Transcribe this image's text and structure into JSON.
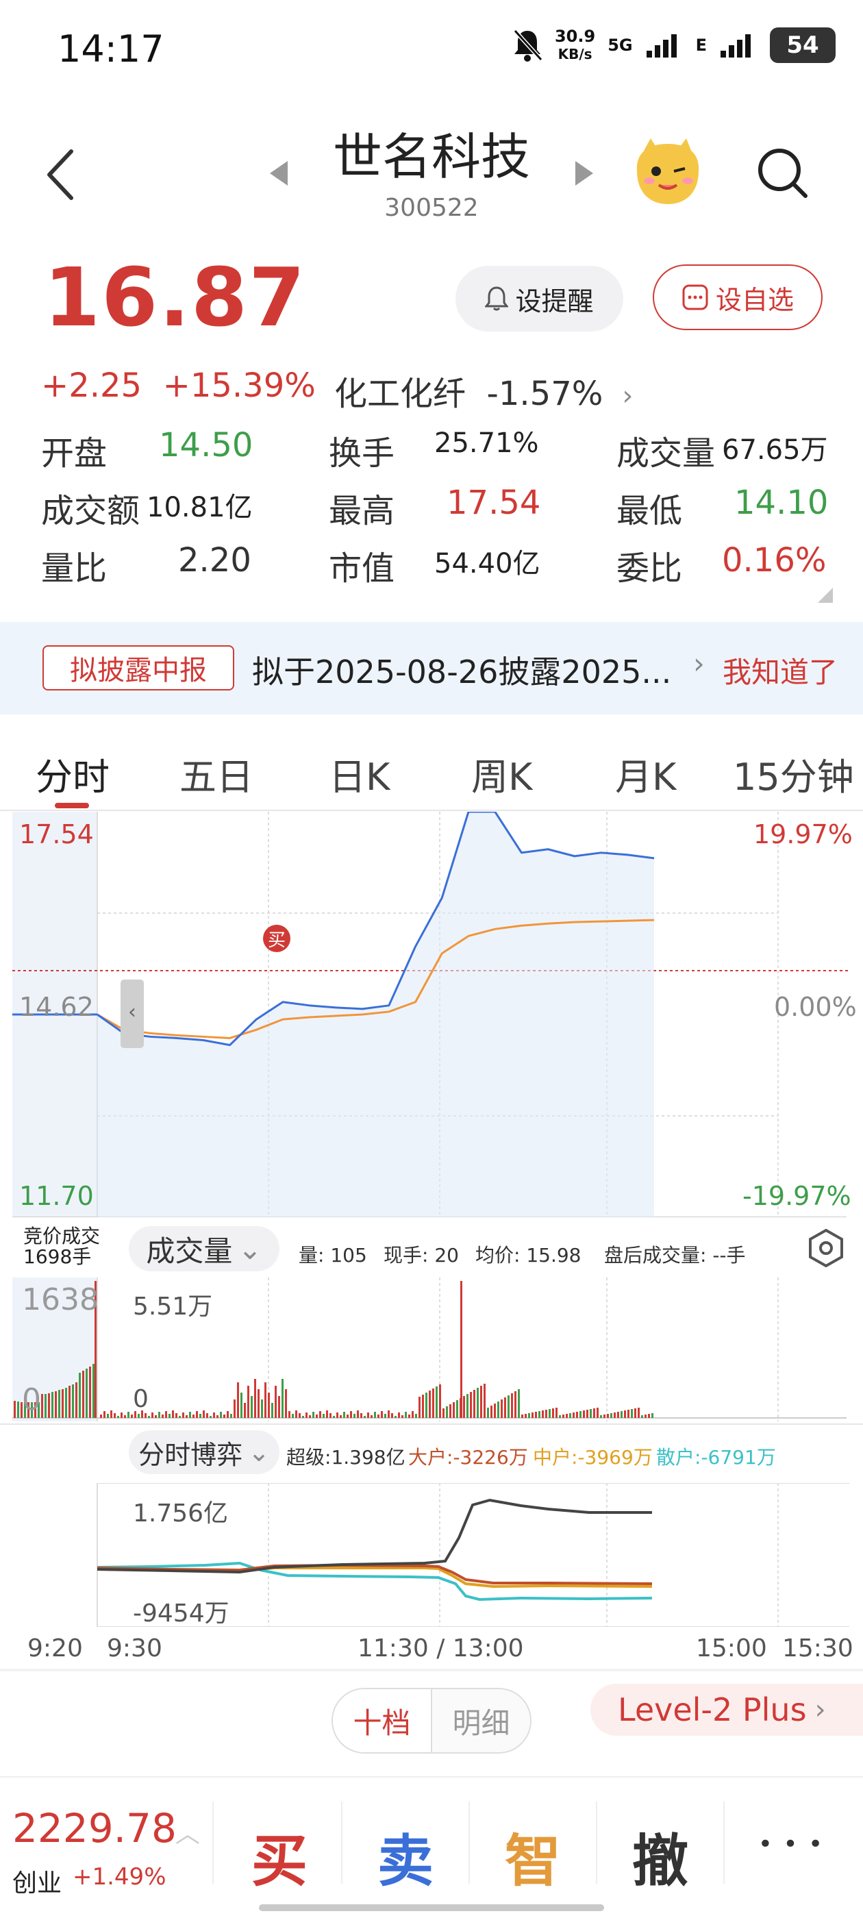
{
  "status_bar": {
    "time": "14:17",
    "net_speed": "30.9",
    "net_unit": "KB/s",
    "net_type": "5G",
    "net_type2": "E",
    "battery": "54"
  },
  "header": {
    "name": "世名科技",
    "code": "300522"
  },
  "quote": {
    "price": "16.87",
    "change": "+2.25",
    "change_pct": "+15.39%",
    "industry": "化工化纤",
    "industry_pct": "-1.57%"
  },
  "buttons": {
    "remind": "设提醒",
    "favorite": "设自选"
  },
  "stats": {
    "open_label": "开盘",
    "open": "14.50",
    "turnover_label": "换手",
    "turnover": "25.71%",
    "volume_label": "成交量",
    "volume": "67.65万",
    "amount_label": "成交额",
    "amount": "10.81亿",
    "high_label": "最高",
    "high": "17.54",
    "low_label": "最低",
    "low": "14.10",
    "vol_ratio_label": "量比",
    "vol_ratio": "2.20",
    "mkt_cap_label": "市值",
    "mkt_cap": "54.40亿",
    "bid_ratio_label": "委比",
    "bid_ratio": "0.16%"
  },
  "notice": {
    "tag": "拟披露中报",
    "text": "拟于2025-08-26披露2025...",
    "link": "我知道了"
  },
  "tabs": [
    "分时",
    "五日",
    "日K",
    "周K",
    "月K",
    "15分钟"
  ],
  "chart_data": [
    {
      "type": "line",
      "title": "分时",
      "series": [],
      "x": [
        "9:20",
        "9:30",
        "11:30 / 13:00",
        "15:00",
        "15:30"
      ],
      "price_points": [
        14.62,
        14.35,
        14.3,
        14.28,
        14.25,
        14.18,
        14.55,
        14.8,
        14.75,
        14.72,
        14.7,
        14.75,
        15.6,
        16.3,
        17.54,
        17.54,
        16.95,
        17.0,
        16.9,
        16.95,
        16.92,
        16.87
      ],
      "avg_points": [
        14.62,
        14.4,
        14.35,
        14.32,
        14.3,
        14.28,
        14.4,
        14.55,
        14.58,
        14.6,
        14.62,
        14.66,
        14.8,
        15.5,
        15.75,
        15.85,
        15.9,
        15.93,
        15.95,
        15.96,
        15.97,
        15.98
      ],
      "y_left": {
        "top": "17.54",
        "mid": "14.62",
        "bottom": "11.70"
      },
      "y_right": {
        "top": "19.97%",
        "mid": "0.00%",
        "bottom": "-19.97%"
      },
      "buy_marker": "买",
      "colors": {
        "price": "#3a6fd8",
        "avg": "#f0953a",
        "up": "#d03a35",
        "down": "#3d9e4a"
      }
    },
    {
      "type": "bar",
      "title": "成交量",
      "auction_label": "竞价成交",
      "auction_volume": "1698手",
      "y_labels": {
        "auction_max": "1638",
        "auction_min": "0",
        "max": "5.51万",
        "min": "0"
      },
      "info": {
        "vol": "量: 105",
        "now": "现手: 20",
        "avg": "均价: 15.98",
        "after": "盘后成交量: --手"
      }
    },
    {
      "type": "line",
      "title": "分时博弈",
      "series": [
        {
          "name": "超级",
          "value": "1.398亿",
          "color": "#444444"
        },
        {
          "name": "大户",
          "value": "-3226万",
          "color": "#c0502a"
        },
        {
          "name": "中户",
          "value": "-3969万",
          "color": "#e0a020"
        },
        {
          "name": "散户",
          "value": "-6791万",
          "color": "#3cc0c8"
        }
      ],
      "y_labels": {
        "max": "1.756亿",
        "min": "-9454万"
      }
    }
  ],
  "depth": {
    "tab_ten": "十档",
    "tab_detail": "明细",
    "level2": "Level-2 Plus"
  },
  "bottom": {
    "index_value": "2229.78",
    "index_name": "创业",
    "index_chg": "+1.49%",
    "buy": "买",
    "sell": "卖",
    "smart": "智",
    "cancel": "撤",
    "more": "• • •"
  }
}
